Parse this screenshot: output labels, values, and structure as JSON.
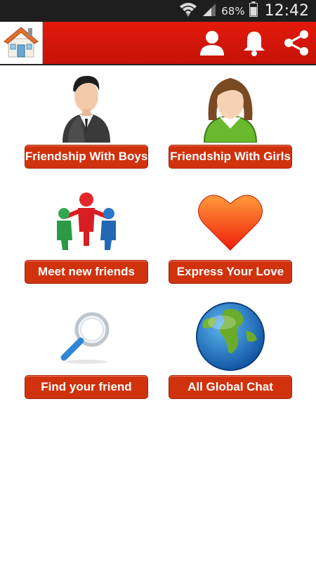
{
  "status_bar": {
    "battery_percent": "68%",
    "time": "12:42",
    "icons": [
      "wifi-icon",
      "signal-icon",
      "battery-icon"
    ]
  },
  "app_bar": {
    "home_icon": "home-icon",
    "actions": [
      "profile-icon",
      "notification-bell-icon",
      "share-icon"
    ],
    "accent_color": "#d81a0d"
  },
  "tiles": [
    {
      "label": "Friendship With Boys",
      "icon": "boy-avatar-icon"
    },
    {
      "label": "Friendship With Girls",
      "icon": "girl-avatar-icon"
    },
    {
      "label": "Meet new friends",
      "icon": "people-group-icon"
    },
    {
      "label": "Express Your Love",
      "icon": "heart-icon"
    },
    {
      "label": "Find your friend",
      "icon": "magnifier-icon"
    },
    {
      "label": "All Global Chat",
      "icon": "globe-icon"
    }
  ],
  "button_color": "#d0320d"
}
